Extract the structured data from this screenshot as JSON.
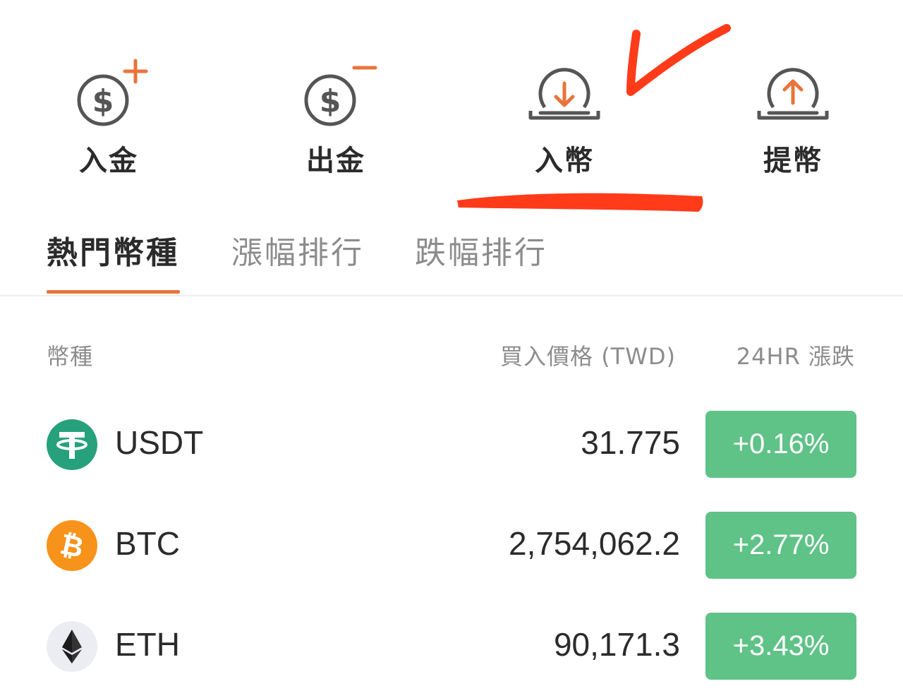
{
  "actions": [
    {
      "label": "入金",
      "icon": "dollar-plus-icon"
    },
    {
      "label": "出金",
      "icon": "dollar-minus-icon"
    },
    {
      "label": "入幣",
      "icon": "coin-deposit-icon"
    },
    {
      "label": "提幣",
      "icon": "coin-withdraw-icon"
    }
  ],
  "tabs": [
    {
      "label": "熱門幣種",
      "active": true
    },
    {
      "label": "漲幅排行",
      "active": false
    },
    {
      "label": "跌幅排行",
      "active": false
    }
  ],
  "table": {
    "headers": {
      "coin": "幣種",
      "price": "買入價格 (TWD)",
      "change": "24HR 漲跌"
    },
    "rows": [
      {
        "symbol": "USDT",
        "price": "31.775",
        "change": "+0.16%",
        "logo": "tether-icon",
        "logo_color": "#26a17b"
      },
      {
        "symbol": "BTC",
        "price": "2,754,062.2",
        "change": "+2.77%",
        "logo": "bitcoin-icon",
        "logo_color": "#f7931a"
      },
      {
        "symbol": "ETH",
        "price": "90,171.3",
        "change": "+3.43%",
        "logo": "ethereum-icon",
        "logo_color": "#ecedf3"
      }
    ]
  },
  "colors": {
    "accent": "#e8743b",
    "positive": "#5fc287",
    "text_primary": "#2b2b2b",
    "text_secondary": "#8c8c8c",
    "annotation": "#ff3b1a"
  }
}
